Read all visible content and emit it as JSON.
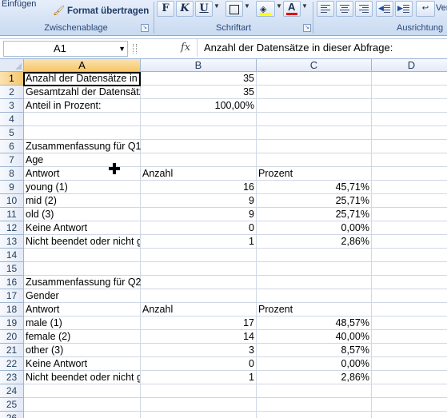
{
  "ribbon": {
    "paste_label": "Einfügen",
    "format_painter_label": "Format übertragen",
    "bold_label": "F",
    "italic_label": "K",
    "underline_label": "U",
    "next_label": "Ver",
    "groups": [
      "Zwischenablage",
      "Schriftart",
      "Ausrichtung"
    ]
  },
  "formula_bar": {
    "name_box": "A1",
    "fx_label": "fx",
    "content": "Anzahl der Datensätze in dieser Abfrage:"
  },
  "sheet": {
    "columns": [
      "A",
      "B",
      "C",
      "D"
    ],
    "rows": [
      {
        "n": "1",
        "a": "Anzahl der Datensätze in dieser Abfrage:",
        "b": "35",
        "c": ""
      },
      {
        "n": "2",
        "a": "Gesamtzahl der Datensätze in dieser Umfrage:",
        "b": "35",
        "c": ""
      },
      {
        "n": "3",
        "a": "Anteil in Prozent:",
        "b": "100,00%",
        "c": ""
      },
      {
        "n": "4",
        "a": "",
        "b": "",
        "c": ""
      },
      {
        "n": "5",
        "a": "",
        "b": "",
        "c": ""
      },
      {
        "n": "6",
        "a": "Zusammenfassung für Q1",
        "b": "",
        "c": ""
      },
      {
        "n": "7",
        "a": "Age",
        "b": "",
        "c": ""
      },
      {
        "n": "8",
        "a": "Antwort",
        "b": "Anzahl",
        "c": "Prozent"
      },
      {
        "n": "9",
        "a": "young (1)",
        "b": "16",
        "c": "45,71%"
      },
      {
        "n": "10",
        "a": "mid (2)",
        "b": "9",
        "c": "25,71%"
      },
      {
        "n": "11",
        "a": "old (3)",
        "b": "9",
        "c": "25,71%"
      },
      {
        "n": "12",
        "a": "Keine Antwort",
        "b": "0",
        "c": "0,00%"
      },
      {
        "n": "13",
        "a": "Nicht beendet oder nicht gezeigt",
        "b": "1",
        "c": "2,86%"
      },
      {
        "n": "14",
        "a": "",
        "b": "",
        "c": ""
      },
      {
        "n": "15",
        "a": "",
        "b": "",
        "c": ""
      },
      {
        "n": "16",
        "a": "Zusammenfassung für Q2",
        "b": "",
        "c": ""
      },
      {
        "n": "17",
        "a": "Gender",
        "b": "",
        "c": ""
      },
      {
        "n": "18",
        "a": "Antwort",
        "b": "Anzahl",
        "c": "Prozent"
      },
      {
        "n": "19",
        "a": "male (1)",
        "b": "17",
        "c": "48,57%"
      },
      {
        "n": "20",
        "a": "female (2)",
        "b": "14",
        "c": "40,00%"
      },
      {
        "n": "21",
        "a": "other (3)",
        "b": "3",
        "c": "8,57%"
      },
      {
        "n": "22",
        "a": "Keine Antwort",
        "b": "0",
        "c": "0,00%"
      },
      {
        "n": "23",
        "a": "Nicht beendet oder nicht gezeigt",
        "b": "1",
        "c": "2,86%"
      },
      {
        "n": "24",
        "a": "",
        "b": "",
        "c": ""
      },
      {
        "n": "25",
        "a": "",
        "b": "",
        "c": ""
      },
      {
        "n": "26",
        "a": "",
        "b": "",
        "c": ""
      }
    ]
  }
}
